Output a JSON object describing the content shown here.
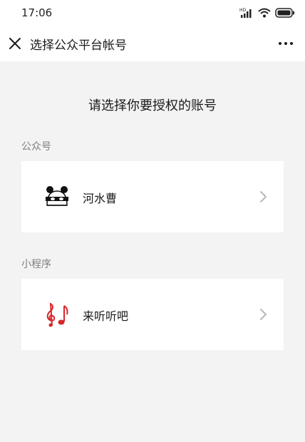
{
  "status_bar": {
    "time": "17:06",
    "network_label": "HD"
  },
  "nav": {
    "title": "选择公众平台帐号"
  },
  "prompt": "请选择你要授权的账号",
  "sections": [
    {
      "label": "公众号",
      "account": {
        "name": "河水曹",
        "avatar_icon": "panda-icon"
      }
    },
    {
      "label": "小程序",
      "account": {
        "name": "来听听吧",
        "avatar_icon": "music-notes-icon"
      }
    }
  ],
  "colors": {
    "background": "#f3f3f3",
    "card": "#ffffff",
    "label_gray": "#7f7f7f",
    "accent_red": "#d8262b"
  }
}
